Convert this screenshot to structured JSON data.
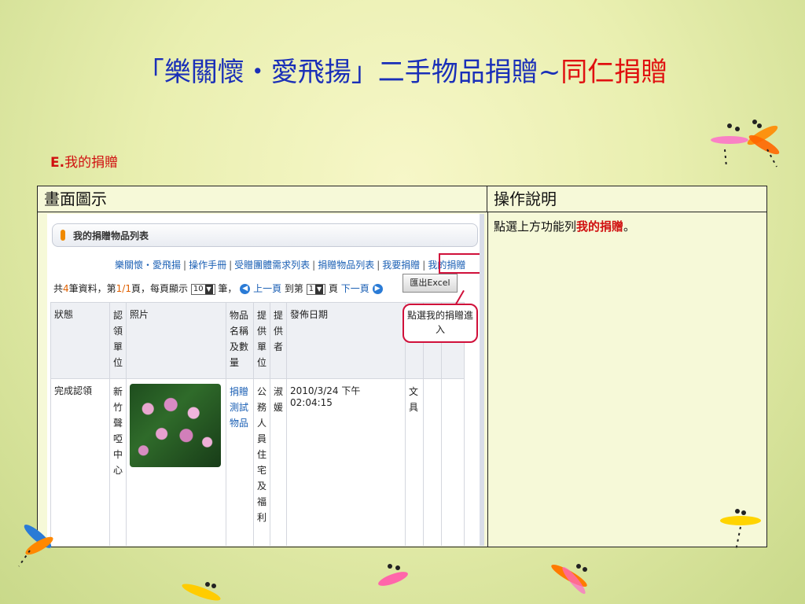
{
  "title": {
    "main": "「樂關懷・愛飛揚」二手物品捐贈~",
    "accent": "同仁捐贈"
  },
  "section": {
    "letter": "E.",
    "label": "我的捐贈"
  },
  "table": {
    "header_left": "畫面圖示",
    "header_right": "操作說明",
    "description_prefix": "點選上方功能列",
    "description_em": "我的捐贈",
    "description_suffix": "。"
  },
  "screenshot": {
    "tab_title": "我的捐贈物品列表",
    "nav": [
      "樂關懷・愛飛揚",
      "操作手冊",
      "受贈團體需求列表",
      "捐贈物品列表",
      "我要捐贈",
      "我的捐贈"
    ],
    "pager": {
      "p1": "共",
      "count": "4",
      "p2": "筆資料，第",
      "page": "1/1",
      "p3": "頁，每頁顯示",
      "per_page": "10",
      "p4": "筆，",
      "prev": "上一頁",
      "p5": "到第",
      "goto": "1",
      "p6": "頁",
      "next": "下一頁"
    },
    "excel_button": "匯出Excel",
    "callout": "點選我的捐贈進入",
    "columns": [
      "狀態",
      "認領單位",
      "照片",
      "物品名稱及數量",
      "提供單位",
      "提供者",
      "發佈日期",
      "",
      "",
      ""
    ],
    "rows": [
      {
        "status": "完成認領",
        "unit": "新竹聲啞中心",
        "item": "捐贈測試物品",
        "provider_unit": "公務人員住宅及福利",
        "provider": "淑媛",
        "date": "2010/3/24 下午 02:04:15",
        "category": "文具"
      }
    ]
  },
  "colors": {
    "title_blue": "#1a2fb8",
    "accent_red": "#e01010",
    "link_blue": "#1a5fb4"
  }
}
